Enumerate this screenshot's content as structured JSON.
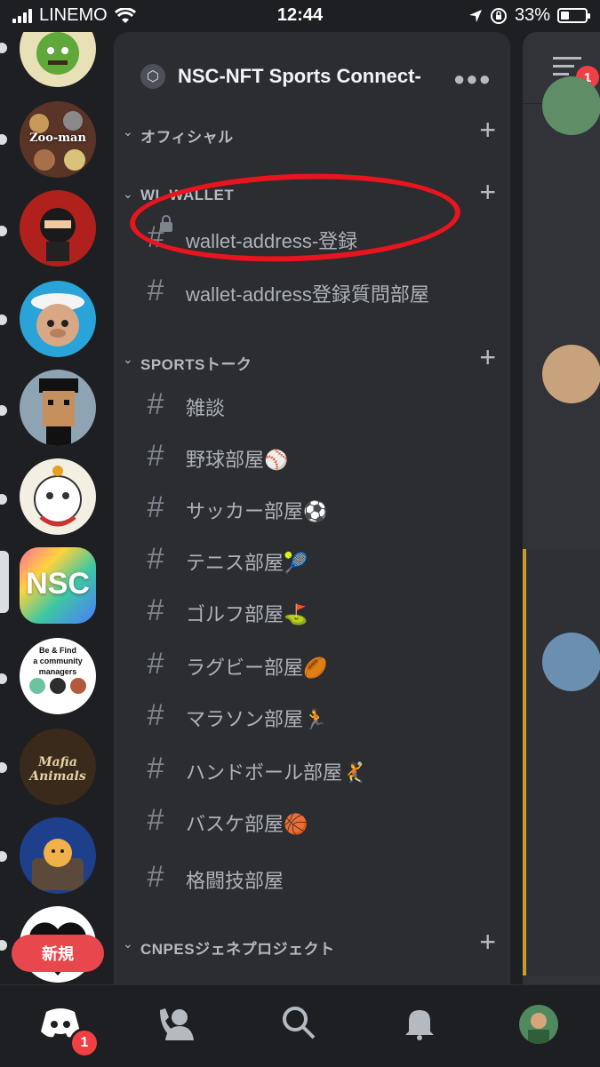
{
  "status_bar": {
    "carrier": "LINEMO",
    "time": "12:44",
    "battery": "33%",
    "battery_level": 0.33
  },
  "server_name": "NSC-NFT Sports Connect-",
  "servers": [
    {
      "name": "zoo-man",
      "text": "Zoo-man"
    },
    {
      "name": "nsc",
      "text": "NSC",
      "selected": true
    },
    {
      "name": "community-managers",
      "text": "Be & Find\na community managers"
    },
    {
      "name": "mafia-animals",
      "text": "Mafia Animals"
    }
  ],
  "new_label": "新規",
  "categories": [
    {
      "label": "オフィシャル",
      "channels": []
    },
    {
      "label": "WL WALLET",
      "channels": [
        {
          "label": "wallet-address-登録",
          "locked": true
        },
        {
          "label": "wallet-address登録質問部屋"
        }
      ]
    },
    {
      "label": "SPORTSトーク",
      "channels": [
        {
          "label": "雑談"
        },
        {
          "label": "野球部屋⚾"
        },
        {
          "label": "サッカー部屋⚽"
        },
        {
          "label": "テニス部屋🎾"
        },
        {
          "label": "ゴルフ部屋⛳"
        },
        {
          "label": "ラグビー部屋🏉"
        },
        {
          "label": "マラソン部屋🏃"
        },
        {
          "label": "ハンドボール部屋🤾"
        },
        {
          "label": "バスケ部屋🏀"
        },
        {
          "label": "格闘技部屋"
        }
      ]
    },
    {
      "label": "CNPESジェネプロジェクト",
      "channels": []
    }
  ],
  "badges": {
    "menu": "1",
    "home": "1"
  },
  "colors": {
    "accent_red": "#e8141e",
    "badge_red": "#f23f43",
    "panel_bg": "#2b2d31"
  }
}
